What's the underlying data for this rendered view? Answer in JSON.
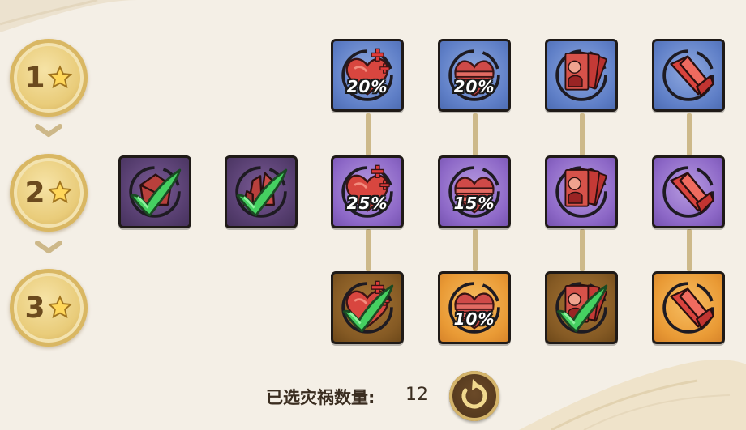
{
  "tiers": [
    {
      "label": "1",
      "icon": "star-icon"
    },
    {
      "label": "2",
      "icon": "star-icon"
    },
    {
      "label": "3",
      "icon": "star-icon"
    }
  ],
  "cards": {
    "r1c3": {
      "icon": "heart-plus-icon",
      "percent": "20%",
      "color": "blue",
      "selected": false
    },
    "r1c4": {
      "icon": "heart-bars-icon",
      "percent": "20%",
      "color": "blue",
      "selected": false
    },
    "r1c5": {
      "icon": "card-fan-icon",
      "color": "blue",
      "selected": false
    },
    "r1c6": {
      "icon": "red-crystal-icon",
      "color": "blue",
      "selected": false
    },
    "r2c1": {
      "icon": "red-gem-icon",
      "color": "dark-purple",
      "selected": true
    },
    "r2c2": {
      "icon": "crystal-cluster-icon",
      "color": "dark-purple",
      "selected": true
    },
    "r2c3": {
      "icon": "heart-plus-icon",
      "percent": "25%",
      "color": "purple",
      "selected": false
    },
    "r2c4": {
      "icon": "heart-bars-icon",
      "percent": "15%",
      "color": "purple",
      "selected": false
    },
    "r2c5": {
      "icon": "card-fan-icon",
      "color": "purple",
      "selected": false
    },
    "r2c6": {
      "icon": "red-crystal-icon",
      "color": "purple",
      "selected": false
    },
    "r3c3": {
      "icon": "heart-plus-icon",
      "color": "dark-orange",
      "selected": true
    },
    "r3c4": {
      "icon": "heart-bars-icon",
      "percent": "10%",
      "color": "orange",
      "selected": false
    },
    "r3c5": {
      "icon": "card-fan-icon",
      "color": "dark-orange",
      "selected": true
    },
    "r3c6": {
      "icon": "red-crystal-icon",
      "color": "orange",
      "selected": false
    }
  },
  "footer": {
    "label": "已选灾祸数量:",
    "count": "12",
    "reset_icon": "refresh-icon"
  },
  "colors": {
    "blue": "#5f7fc7",
    "purple": "#8d68c7",
    "orange": "#e99a35",
    "check": "#3fc65a",
    "badge_gold": "#e9cc7a"
  }
}
